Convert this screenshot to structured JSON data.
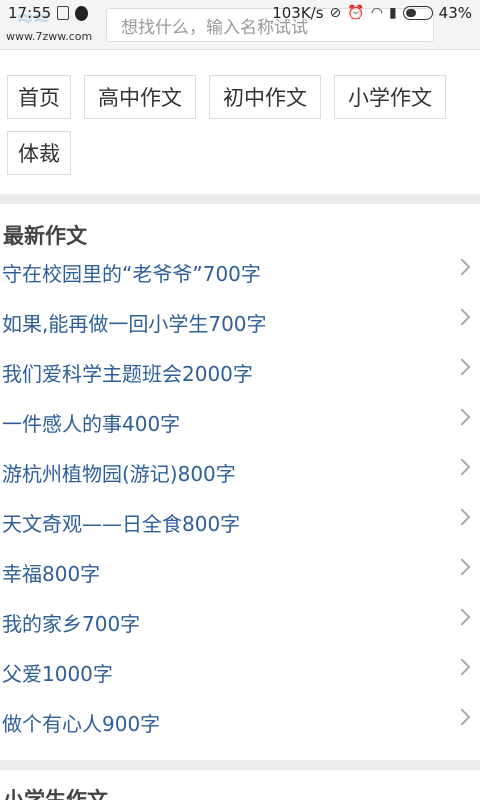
{
  "status_bar": {
    "time": "17:55",
    "speed": "103K/s",
    "battery": "43%"
  },
  "header": {
    "logo_url": "www.7zww.com",
    "search_placeholder": "想找什么，输入名称试试"
  },
  "nav": {
    "tags": [
      "首页",
      "高中作文",
      "初中作文",
      "小学作文",
      "体裁"
    ]
  },
  "sections": {
    "latest_title": "最新作文",
    "next_title": "小学生作文"
  },
  "articles": [
    "守在校园里的“老爷爷”700字",
    "如果,能再做一回小学生700字",
    "我们爱科学主题班会2000字",
    "一件感人的事400字",
    "游杭州植物园(游记)800字",
    "天文奇观——日全食800字",
    "幸福800字",
    "我的家乡700字",
    "父爱1000字",
    "做个有心人900字"
  ]
}
